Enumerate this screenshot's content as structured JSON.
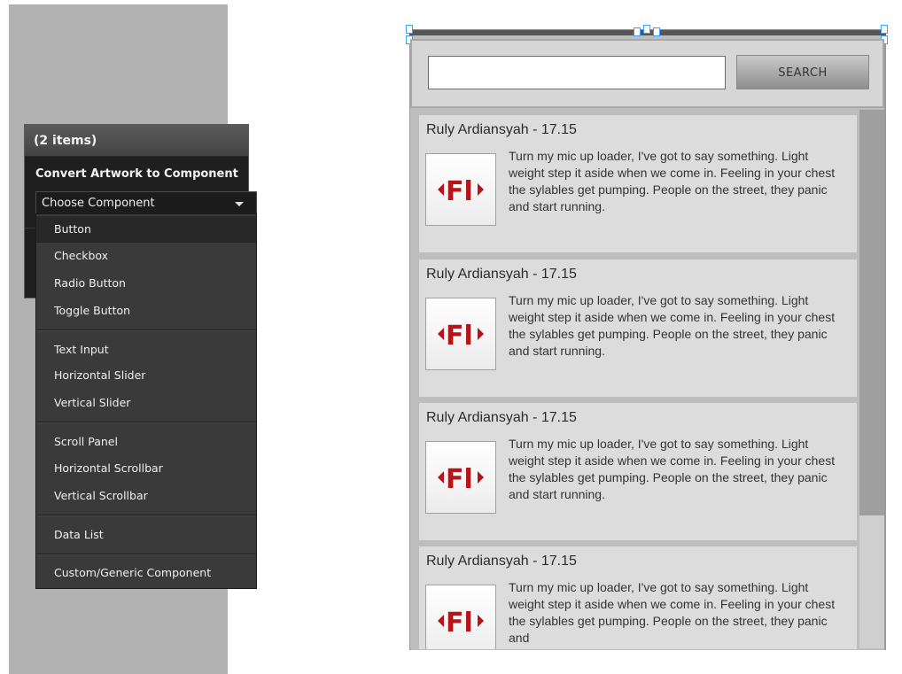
{
  "panel": {
    "header": "(2 items)",
    "subtitle": "Convert Artwork to Component",
    "select_value": "Choose Component"
  },
  "menu": {
    "items": [
      "Button",
      "Checkbox",
      "Radio Button",
      "Toggle Button",
      "Text Input",
      "Horizontal Slider",
      "Vertical Slider",
      "Scroll Panel",
      "Horizontal Scrollbar",
      "Vertical Scrollbar",
      "Data List",
      "Custom/Generic Component"
    ]
  },
  "search": {
    "button_label": "SEARCH",
    "input_value": ""
  },
  "list": {
    "items": [
      {
        "title": "Ruly Ardiansyah - 17.15",
        "text": "Turn my mic up loader, I've got to say something. Light weight step it aside when we come in. Feeling in your chest the sylables get pumping. People on the street, they panic and start running."
      },
      {
        "title": "Ruly Ardiansyah - 17.15",
        "text": "Turn my mic up loader, I've got to say something. Light weight step it aside when we come in. Feeling in your chest the sylables get pumping. People on the street, they panic and start running."
      },
      {
        "title": "Ruly Ardiansyah - 17.15",
        "text": "Turn my mic up loader, I've got to say something. Light weight step it aside when we come in. Feeling in your chest the sylables get pumping. People on the street, they panic and start running."
      },
      {
        "title": "Ruly Ardiansyah - 17.15",
        "text": "Turn my mic up loader, I've got to say something. Light weight step it aside when we come in. Feeling in your chest the sylables get pumping. People on the street, they panic and"
      }
    ]
  },
  "colors": {
    "panel_bg": "#1f1f1f",
    "menu_bg": "#3a3a3a",
    "selection_blue": "#3aa0ff",
    "flash_red": "#b3151b"
  },
  "icons": {
    "list_thumb": "flash-file-icon",
    "select_caret": "chevron-down-icon"
  }
}
